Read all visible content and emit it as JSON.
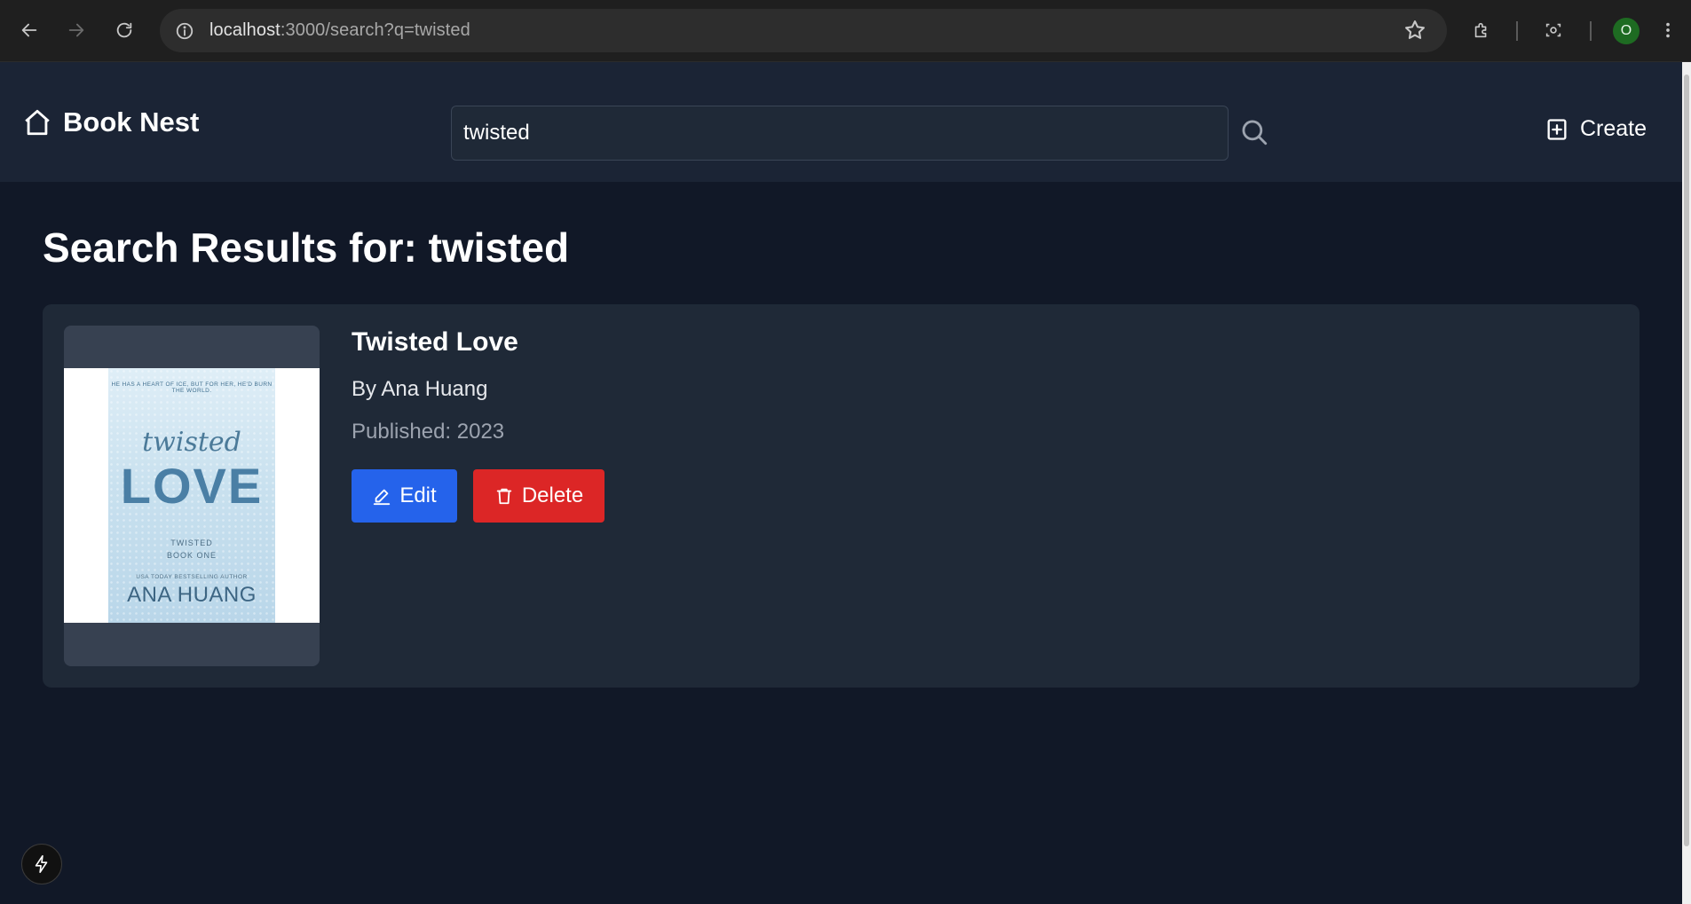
{
  "browser": {
    "url_host": "localhost",
    "url_rest": ":3000/search?q=twisted",
    "profile_initial": "O"
  },
  "header": {
    "brand": "Book Nest",
    "search_value": "twisted",
    "create_label": "Create"
  },
  "main": {
    "title_prefix": "Search Results for: ",
    "title_query": "twisted",
    "results": [
      {
        "title": "Twisted Love",
        "author_line": "By Ana Huang",
        "published_line": "Published: 2023",
        "cover": {
          "tagline": "HE HAS A HEART OF ICE, BUT FOR HER, HE'D BURN THE WORLD.",
          "script_word": "twisted",
          "main_word": "LOVE",
          "series_line1": "TWISTED",
          "series_line2": "BOOK ONE",
          "usa_line": "USA TODAY BESTSELLING AUTHOR",
          "author": "ANA HUANG"
        },
        "edit_label": "Edit",
        "delete_label": "Delete"
      }
    ]
  },
  "colors": {
    "page_bg": "#111827",
    "header_bg": "#1b2435",
    "card_bg": "#1f2937",
    "edit_bg": "#2563eb",
    "delete_bg": "#dc2626"
  }
}
